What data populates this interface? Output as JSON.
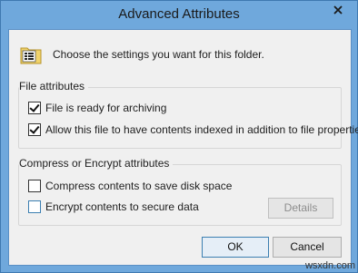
{
  "window": {
    "title": "Advanced Attributes"
  },
  "header": {
    "text": "Choose the settings you want for this folder."
  },
  "file_attributes": {
    "title": "File attributes",
    "archive": {
      "label": "File is ready for archiving",
      "checked": true
    },
    "index": {
      "label": "Allow this file to have contents indexed in addition to file properties",
      "checked": true
    }
  },
  "compress_encrypt": {
    "title": "Compress or Encrypt attributes",
    "compress": {
      "label": "Compress contents to save disk space",
      "checked": false
    },
    "encrypt": {
      "label": "Encrypt contents to secure data",
      "checked": false
    },
    "details_label": "Details"
  },
  "buttons": {
    "ok": "OK",
    "cancel": "Cancel"
  },
  "watermark": "wsxdn.com"
}
